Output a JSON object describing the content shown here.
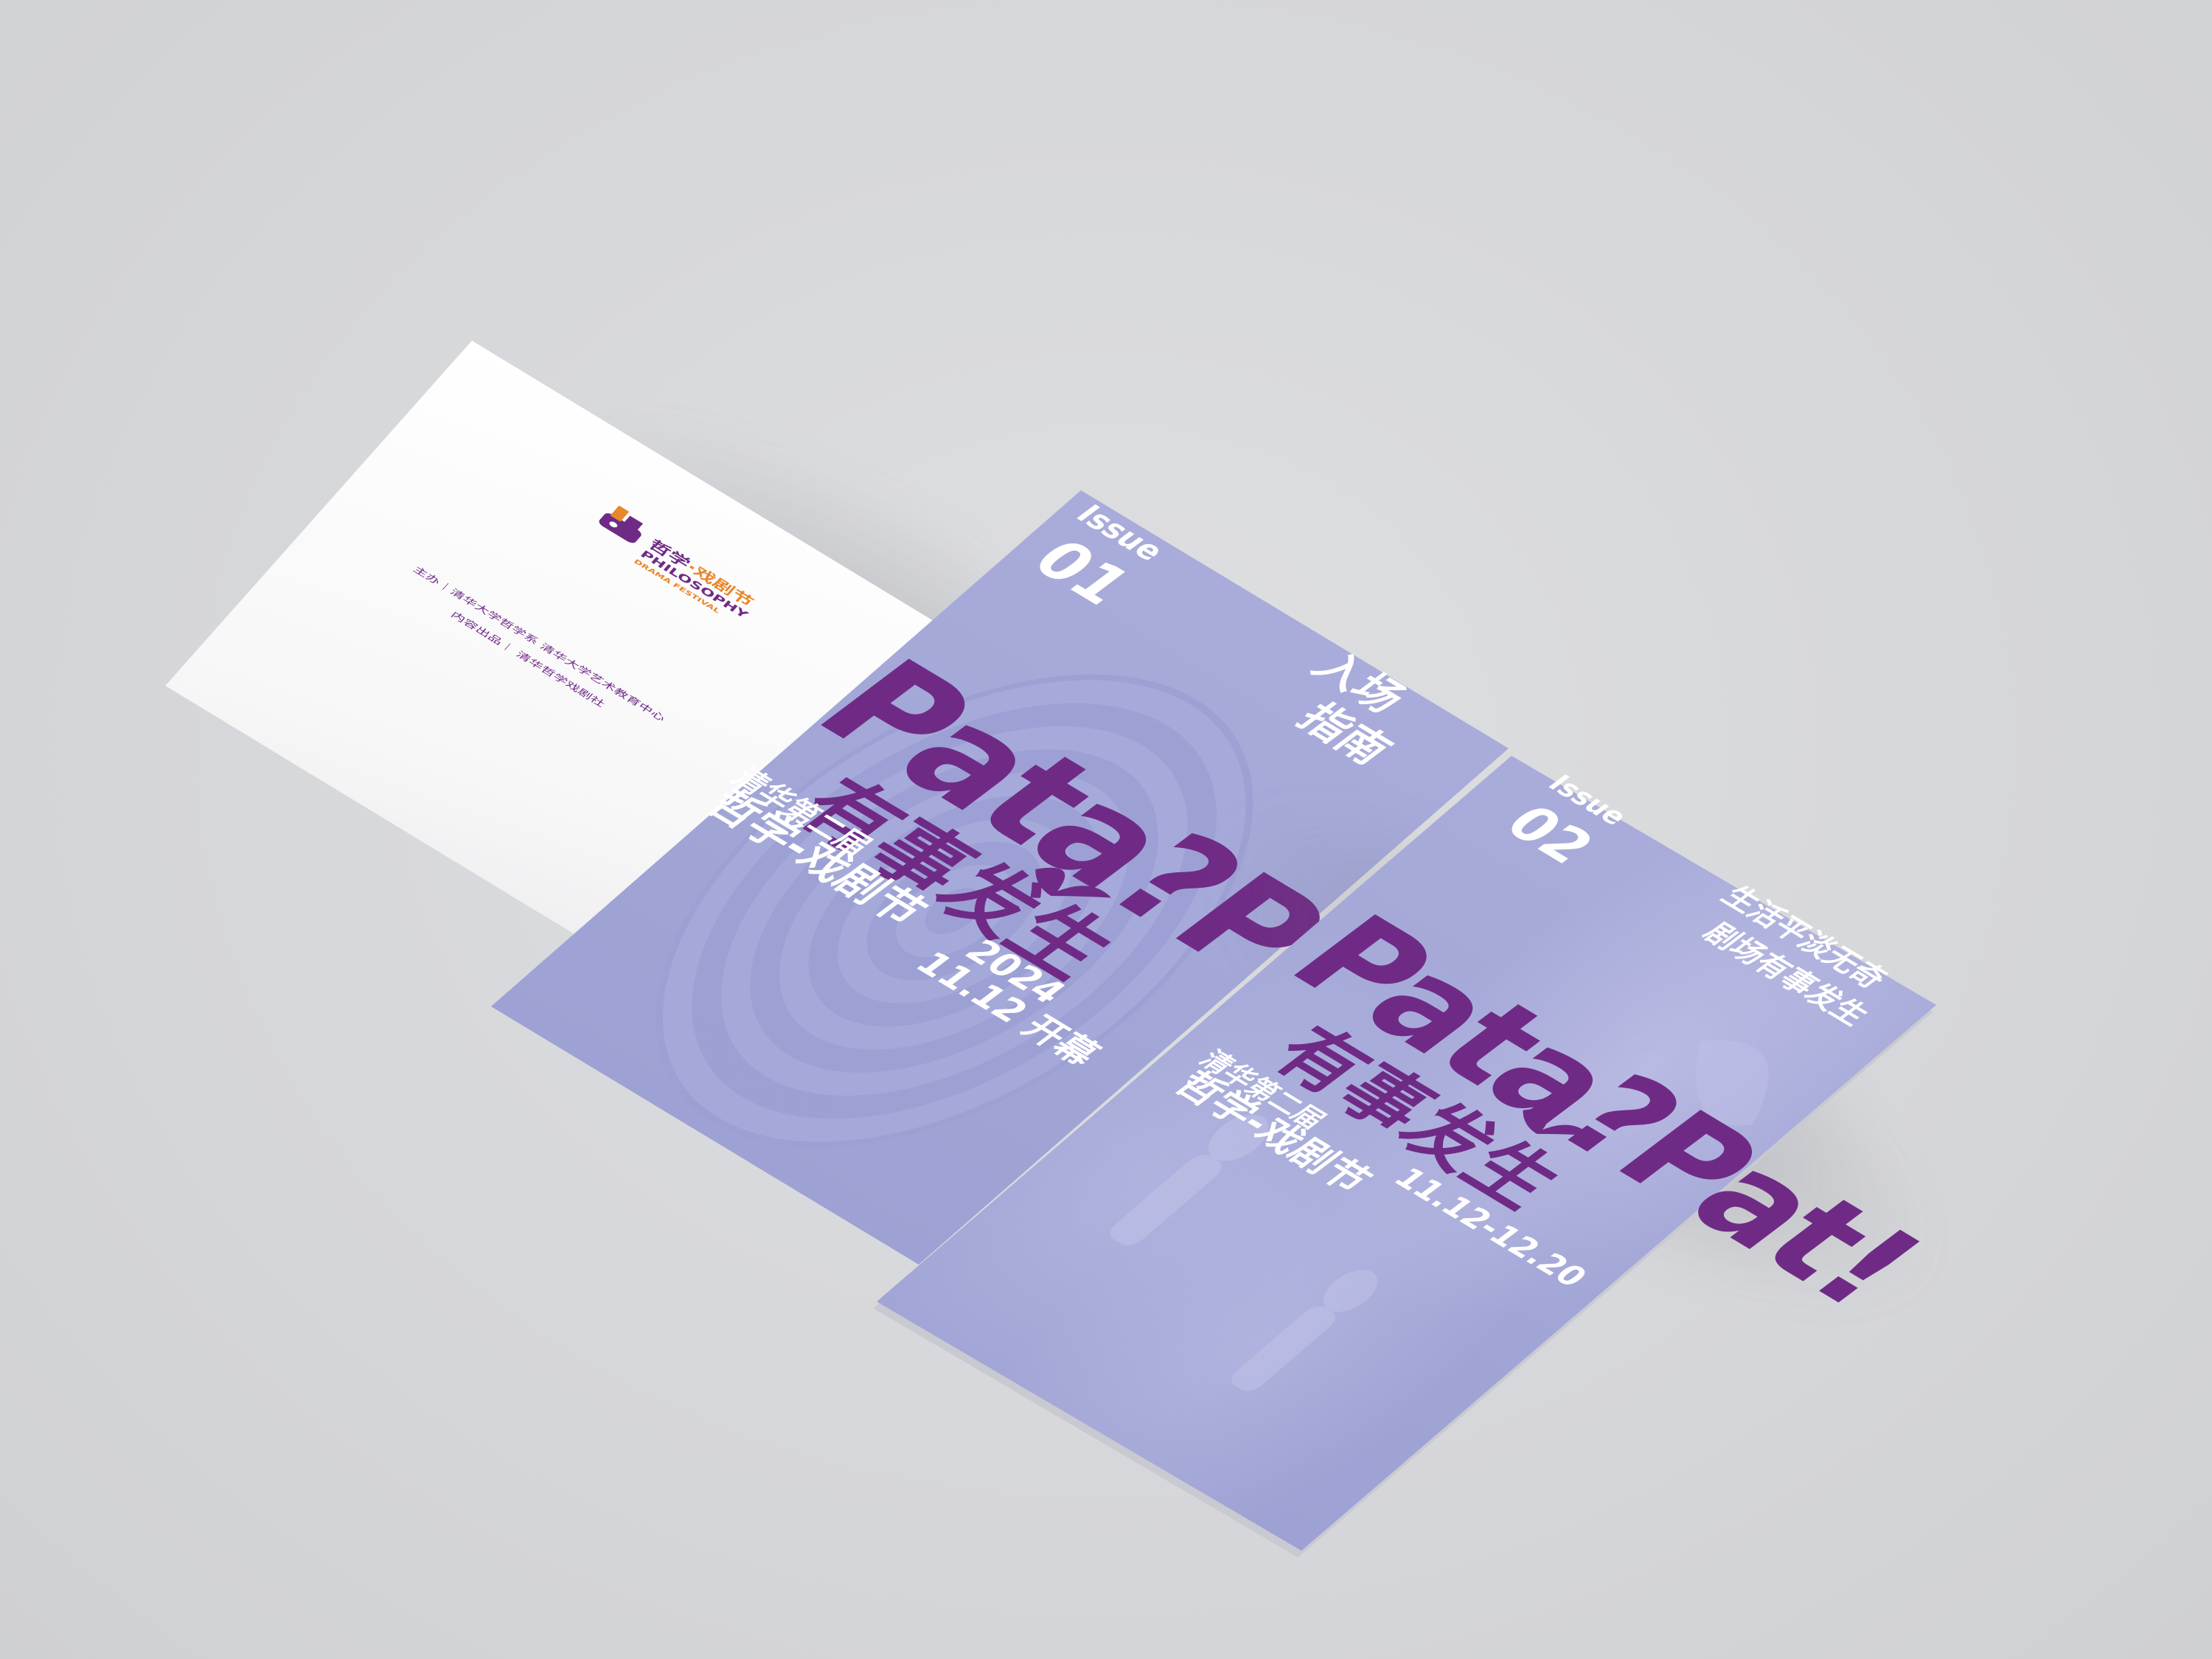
{
  "booklet_1": {
    "issue_label": "Issue",
    "issue_number": "01",
    "title_latin": "Pata?Pat!",
    "title_cn": "有事发生",
    "tagline": [
      "入场",
      "指南"
    ],
    "festival_sub": "清华第二届",
    "festival_name": "哲学-戏剧节",
    "year": "2024",
    "opening": "11.12 开幕"
  },
  "booklet_2": {
    "issue_label": "Issue",
    "issue_number": "02",
    "title_latin": "Pata?Pat!",
    "title_cn": "有事发生",
    "tagline": [
      "生活平淡无奇",
      "剧场有事发生"
    ],
    "festival_sub": "清华第二届",
    "festival_name": "哲学-戏剧节",
    "dates": "11.12-12.20"
  },
  "back_cover": {
    "logo_cn_1": "哲学",
    "logo_cn_2": "·戏剧节",
    "logo_en_1": "PHILOSOPHY",
    "logo_en_2": "DRAMA FESTIVAL",
    "credit_line_1": "主办｜清华大学哲学系 清华大学艺术教育中心",
    "credit_line_2": "内容出品｜ 清华哲学戏剧社"
  },
  "colors": {
    "background": "#d6d7da",
    "cover_lavender": "#a5a9d8",
    "title_purple": "#6f2a86",
    "logo_orange": "#e8872b"
  }
}
